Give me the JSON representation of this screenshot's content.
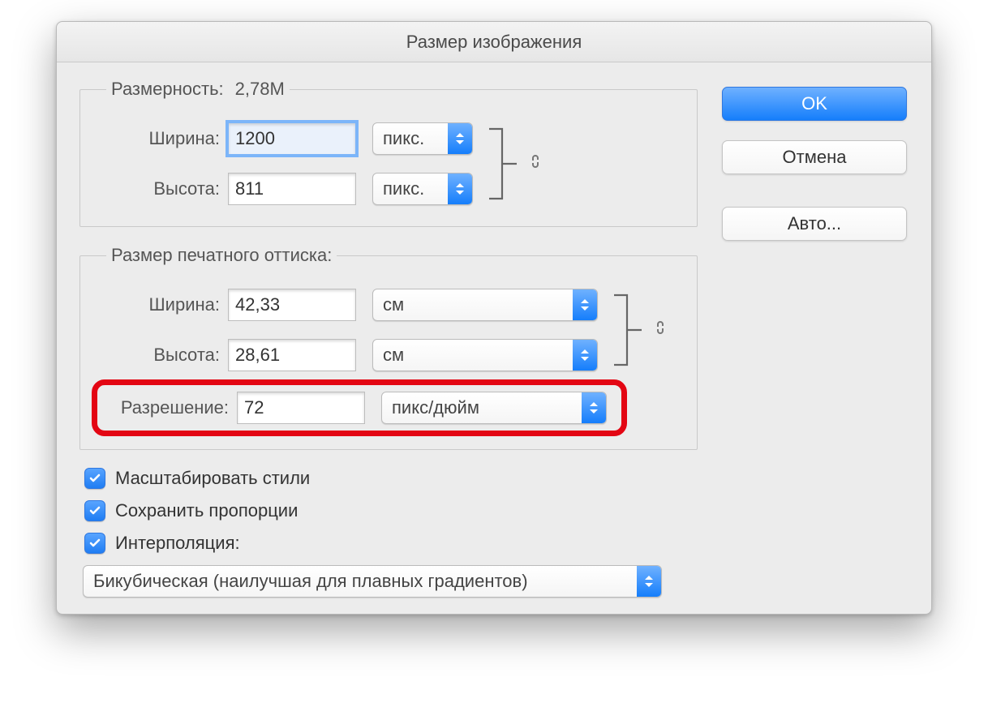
{
  "dialog": {
    "title": "Размер изображения"
  },
  "buttons": {
    "ok": "OK",
    "cancel": "Отмена",
    "auto": "Авто..."
  },
  "pixel_dimensions": {
    "legend": "Размерность:",
    "size_value": "2,78M",
    "width_label": "Ширина:",
    "width_value": "1200",
    "width_unit": "пикс.",
    "height_label": "Высота:",
    "height_value": "811",
    "height_unit": "пикс."
  },
  "document_size": {
    "legend": "Размер печатного оттиска:",
    "width_label": "Ширина:",
    "width_value": "42,33",
    "width_unit": "см",
    "height_label": "Высота:",
    "height_value": "28,61",
    "height_unit": "см",
    "resolution_label": "Разрешение:",
    "resolution_value": "72",
    "resolution_unit": "пикс/дюйм"
  },
  "options": {
    "scale_styles": "Масштабировать стили",
    "constrain_proportions": "Сохранить пропорции",
    "resample": "Интерполяция:"
  },
  "interpolation": {
    "value": "Бикубическая (наилучшая для плавных градиентов)"
  }
}
